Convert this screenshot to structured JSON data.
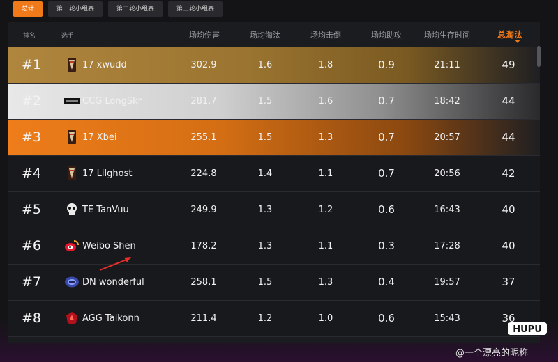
{
  "tabs": [
    {
      "label": "总计",
      "active": true
    },
    {
      "label": "第一轮小组赛",
      "active": false
    },
    {
      "label": "第二轮小组赛",
      "active": false
    },
    {
      "label": "第三轮小组赛",
      "active": false
    }
  ],
  "columns": {
    "rank": "排名",
    "player": "选手",
    "avg_damage": "场均伤害",
    "avg_kills": "场均淘汰",
    "avg_knocks": "场均击倒",
    "avg_assists": "场均助攻",
    "avg_survival": "场均生存时间",
    "total_kills": "总淘汰"
  },
  "sorted_column": "total_kills",
  "rows": [
    {
      "rank": "#1",
      "player": "17 xwudd",
      "team_icon": "team-17-icon",
      "avg_damage": "302.9",
      "avg_kills": "1.6",
      "avg_knocks": "1.8",
      "avg_assists": "0.9",
      "avg_survival": "21:11",
      "total_kills": "49",
      "highlight": "gold"
    },
    {
      "rank": "#2",
      "player": "CCG LongSkr",
      "team_icon": "team-ccg-icon",
      "avg_damage": "281.7",
      "avg_kills": "1.5",
      "avg_knocks": "1.6",
      "avg_assists": "0.7",
      "avg_survival": "18:42",
      "total_kills": "44",
      "highlight": "silver"
    },
    {
      "rank": "#3",
      "player": "17 Xbei",
      "team_icon": "team-17-icon",
      "avg_damage": "255.1",
      "avg_kills": "1.5",
      "avg_knocks": "1.3",
      "avg_assists": "0.7",
      "avg_survival": "20:57",
      "total_kills": "44",
      "highlight": "bronze"
    },
    {
      "rank": "#4",
      "player": "17 Lilghost",
      "team_icon": "team-17-icon",
      "avg_damage": "224.8",
      "avg_kills": "1.4",
      "avg_knocks": "1.1",
      "avg_assists": "0.7",
      "avg_survival": "20:56",
      "total_kills": "42",
      "highlight": "none"
    },
    {
      "rank": "#5",
      "player": "TE TanVuu",
      "team_icon": "team-te-skull-icon",
      "avg_damage": "249.9",
      "avg_kills": "1.3",
      "avg_knocks": "1.2",
      "avg_assists": "0.6",
      "avg_survival": "16:43",
      "total_kills": "40",
      "highlight": "none"
    },
    {
      "rank": "#6",
      "player": "Weibo Shen",
      "team_icon": "team-weibo-icon",
      "avg_damage": "178.2",
      "avg_kills": "1.3",
      "avg_knocks": "1.1",
      "avg_assists": "0.3",
      "avg_survival": "17:28",
      "total_kills": "40",
      "highlight": "none"
    },
    {
      "rank": "#7",
      "player": "DN wonderful",
      "team_icon": "team-dn-icon",
      "avg_damage": "258.1",
      "avg_kills": "1.5",
      "avg_knocks": "1.3",
      "avg_assists": "0.4",
      "avg_survival": "19:57",
      "total_kills": "37",
      "highlight": "none"
    },
    {
      "rank": "#8",
      "player": "AGG Taikonn",
      "team_icon": "team-agg-icon",
      "avg_damage": "211.4",
      "avg_kills": "1.2",
      "avg_knocks": "1.0",
      "avg_assists": "0.6",
      "avg_survival": "15:43",
      "total_kills": "36",
      "highlight": "none"
    }
  ],
  "watermark": {
    "logo_text": "HUPU",
    "credit": "@一个漂亮的昵称"
  },
  "colors": {
    "accent": "#f07a1a",
    "gold": "#b0863e",
    "silver": "#d8d8d8",
    "bronze": "#ee7d1a",
    "annotation_arrow": "#e8302a"
  }
}
